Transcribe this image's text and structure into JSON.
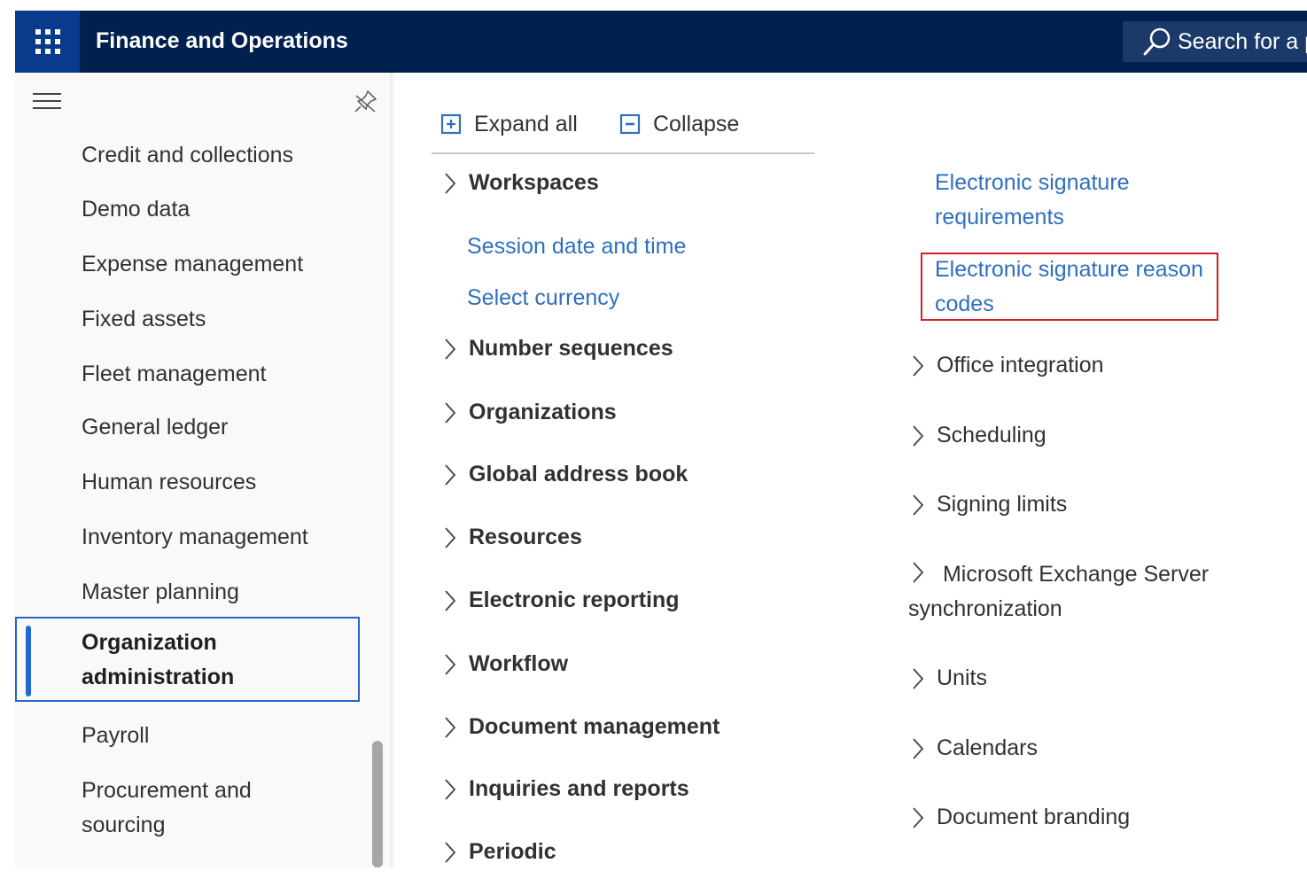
{
  "header": {
    "app_title": "Finance and Operations",
    "search_placeholder": "Search for a p"
  },
  "sidebar": {
    "items": [
      {
        "label": "Credit and collections"
      },
      {
        "label": "Demo data"
      },
      {
        "label": "Expense management"
      },
      {
        "label": "Fixed assets"
      },
      {
        "label": "Fleet management"
      },
      {
        "label": "General ledger"
      },
      {
        "label": "Human resources"
      },
      {
        "label": "Inventory management"
      },
      {
        "label": "Master planning"
      },
      {
        "label": "Organization administration",
        "selected": true
      },
      {
        "label": "Payroll"
      },
      {
        "label": "Procurement and sourcing"
      }
    ]
  },
  "toolbar": {
    "expand_all_label": "Expand all",
    "collapse_label": "Collapse"
  },
  "main": {
    "column1": {
      "workspaces": "Workspaces",
      "workspace_links": [
        "Session date and time",
        "Select currency"
      ],
      "groups": [
        "Number sequences",
        "Organizations",
        "Global address book",
        "Resources",
        "Electronic reporting",
        "Workflow",
        "Document management",
        "Inquiries and reports",
        "Periodic"
      ]
    },
    "column2": {
      "links": [
        "Electronic signature requirements",
        "Electronic signature reason codes"
      ],
      "highlighted_link": "Electronic signature reason codes",
      "groups": [
        "Office integration",
        "Scheduling",
        "Signing limits",
        "Microsoft Exchange Server synchronization",
        "Units",
        "Calendars",
        "Document branding"
      ]
    }
  },
  "colors": {
    "header_bg": "#002050",
    "link": "#2f6fbf",
    "selection": "#2266cc",
    "highlight_box": "#d0202a"
  }
}
